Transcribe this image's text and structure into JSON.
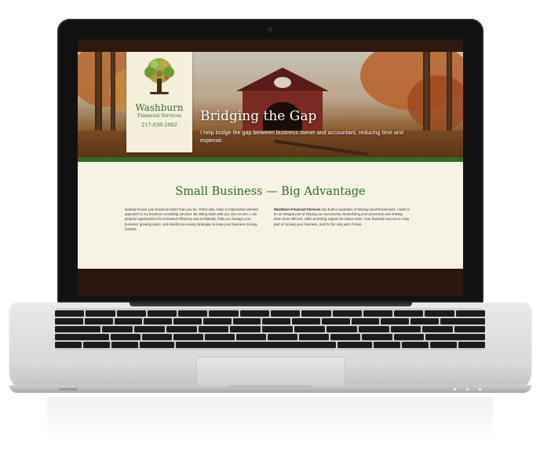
{
  "site": {
    "logo": {
      "name": "Washburn",
      "subtitle": "Financial Services",
      "phone": "217-638-2002"
    },
    "hero": {
      "title": "Bridging the Gap",
      "text": "I help bridge the gap between business owner and accountant, reducing time and expense."
    },
    "section": {
      "title": "Small Business — Big Advantage",
      "left_paragraph": "Nobody knows your business better than you do. That's why I take a relationship-oriented approach to my business consulting services. By sitting down with you one-on-one, I can pinpoint opportunities for increased efficiency and profitability, help you manage your business' growing pains, and identify tax-saving strategies to keep your business moving forward.",
      "right_bold": "Washburn Financial Services",
      "right_paragraph": " has built a reputation of helping small businesses. I want to be an integral part of helping you succeed by streamlining your processes and making them more efficient, while providing support as issues arise. Your financial success is a big part of running your business, and it's the only part of mine."
    },
    "colors": {
      "brand_green": "#2f6b23",
      "content_bg": "#f7f3e4",
      "dark_brown": "#2b170f"
    }
  },
  "device": {
    "type": "laptop",
    "icons": [
      "webcam-icon"
    ]
  }
}
